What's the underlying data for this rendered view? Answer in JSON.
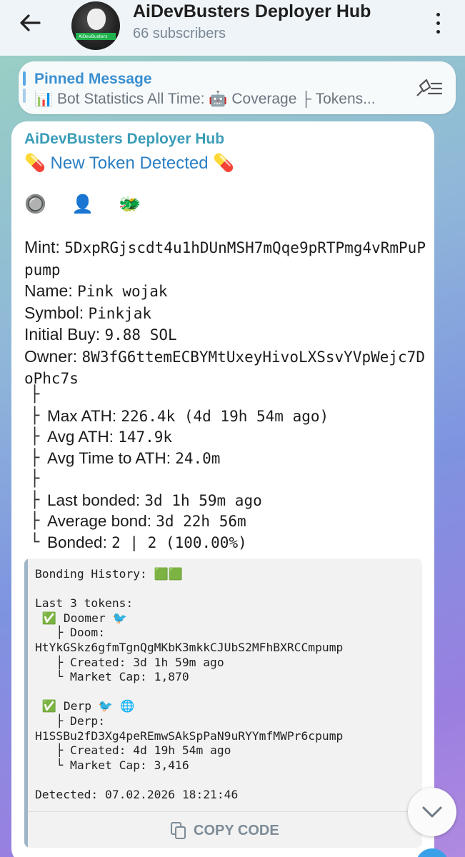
{
  "header": {
    "channel_title": "AiDevBusters Deployer Hub",
    "subscribers": "66 subscribers",
    "avatar_text": "AiDevBusters"
  },
  "pinned": {
    "title": "Pinned Message",
    "text": "📊 Bot Statistics All Time: 🤖 Coverage   ├ Tokens..."
  },
  "message": {
    "sender": "AiDevBusters Deployer Hub",
    "headline": "💊 New Token Detected 💊",
    "emoji_row": "🔘 👤 🐲",
    "mint_label": "Mint: ",
    "mint_value": "5DxpRGjscdt4u1hDUnMSH7mQqe9pRTPmg4vRmPuPpump",
    "name_label": "Name: ",
    "name_value": "Pink wojak",
    "symbol_label": "Symbol: ",
    "symbol_value": "Pinkjak",
    "initial_buy_label": "Initial Buy: ",
    "initial_buy_value": "9.88 SOL",
    "owner_label": "Owner: ",
    "owner_value": "8W3fG6ttemECBYMtUxeyHivoLXSsvYVpWejc7DoPhc7s",
    "stats": {
      "max_ath_label": "Max ATH: ",
      "max_ath_value": "226.4k (4d 19h 54m ago)",
      "avg_ath_label": "Avg ATH: ",
      "avg_ath_value": "147.9k",
      "avg_time_label": "Avg Time to ATH: ",
      "avg_time_value": "24.0m",
      "last_bonded_label": "Last bonded: ",
      "last_bonded_value": "3d 1h 59m ago",
      "avg_bond_label": "Average bond: ",
      "avg_bond_value": "3d 22h 56m",
      "bonded_label": "Bonded: ",
      "bonded_value": "2 | 2 (100.00%)"
    },
    "code": {
      "bonding_history": "Bonding History: 🟩🟩",
      "last_tokens_label": "Last 3 tokens:",
      "tokens": [
        {
          "name_line": " ✅ Doomer 🐦",
          "symbol_line": "   ├ Doom:",
          "address": "HtYkGSkz6gfmTgnQgMKbK3mkkCJUbS2MFhBXRCCmpump",
          "created": "   ├ Created: 3d 1h 59m ago",
          "mcap": "   └ Market Cap: 1,870"
        },
        {
          "name_line": " ✅ Derp 🐦 🌐",
          "symbol_line": "   ├ Derp:",
          "address": "H1SSBu2fD3Xg4peREmwSAkSpPaN9uRYYmfMWPr6cpump",
          "created": "   ├ Created: 4d 19h 54m ago",
          "mcap": "   └ Market Cap: 3,416"
        }
      ],
      "detected": "Detected: 07.02.2026 18:21:46",
      "copy_label": "COPY CODE"
    }
  }
}
